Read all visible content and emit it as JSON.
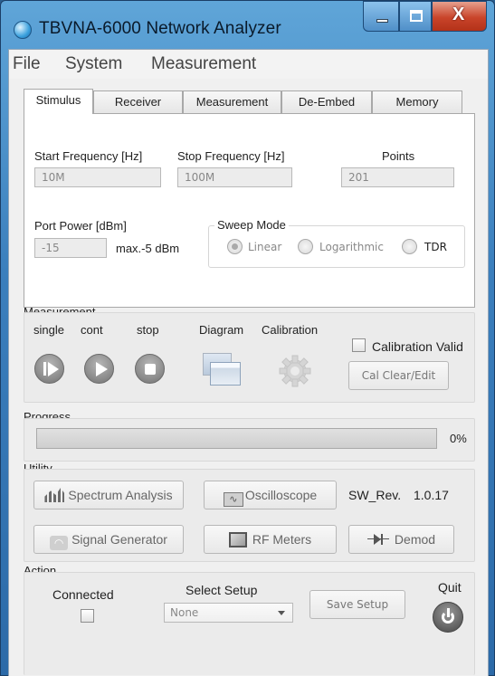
{
  "window": {
    "title": "TBVNA-6000 Network Analyzer",
    "icon": "globe-icon",
    "controls": {
      "minimize": "minimize-icon",
      "maximize": "maximize-icon",
      "close_label": "X"
    }
  },
  "menu": {
    "items": [
      "File",
      "System",
      "Measurement"
    ]
  },
  "tabs": [
    "Stimulus",
    "Receiver",
    "Measurement",
    "De-Embed",
    "Memory"
  ],
  "active_tab": "Stimulus",
  "stimulus": {
    "start_label": "Start Frequency [Hz]",
    "start_value": "10M",
    "stop_label": "Stop Frequency [Hz]",
    "stop_value": "100M",
    "points_label": "Points",
    "points_value": "201",
    "power_label": "Port  Power [dBm]",
    "power_value": "-15",
    "power_max": "max.-5 dBm",
    "sweep_title": "Sweep Mode",
    "sweep_options": [
      "Linear",
      "Logarithmic",
      "TDR"
    ],
    "sweep_selected": "Linear"
  },
  "measurement": {
    "title": "Measurement",
    "single": "single",
    "cont": "cont",
    "stop": "stop",
    "diagram": "Diagram",
    "calibration": "Calibration",
    "calibration_valid": "Calibration Valid",
    "calibration_valid_checked": false,
    "cal_clear": "Cal Clear/Edit"
  },
  "progress": {
    "title": "Progress",
    "value": 0,
    "label": "0%"
  },
  "utility": {
    "title": "Utility",
    "spectrum": "Spectrum Analysis",
    "oscilloscope": "Oscilloscope",
    "sw_rev_label": "SW_Rev.",
    "sw_rev_value": "1.0.17",
    "signal_generator": "Signal Generator",
    "rf_meters": "RF Meters",
    "demod": "Demod"
  },
  "action": {
    "title": "Action",
    "connected": "Connected",
    "connected_checked": false,
    "select_setup_label": "Select Setup",
    "select_setup_value": "None",
    "save_setup": "Save Setup",
    "quit": "Quit"
  },
  "colors": {
    "titlebar": "#3b7fbd",
    "close_button": "#c9442a",
    "panel_bg": "#ebebeb"
  }
}
